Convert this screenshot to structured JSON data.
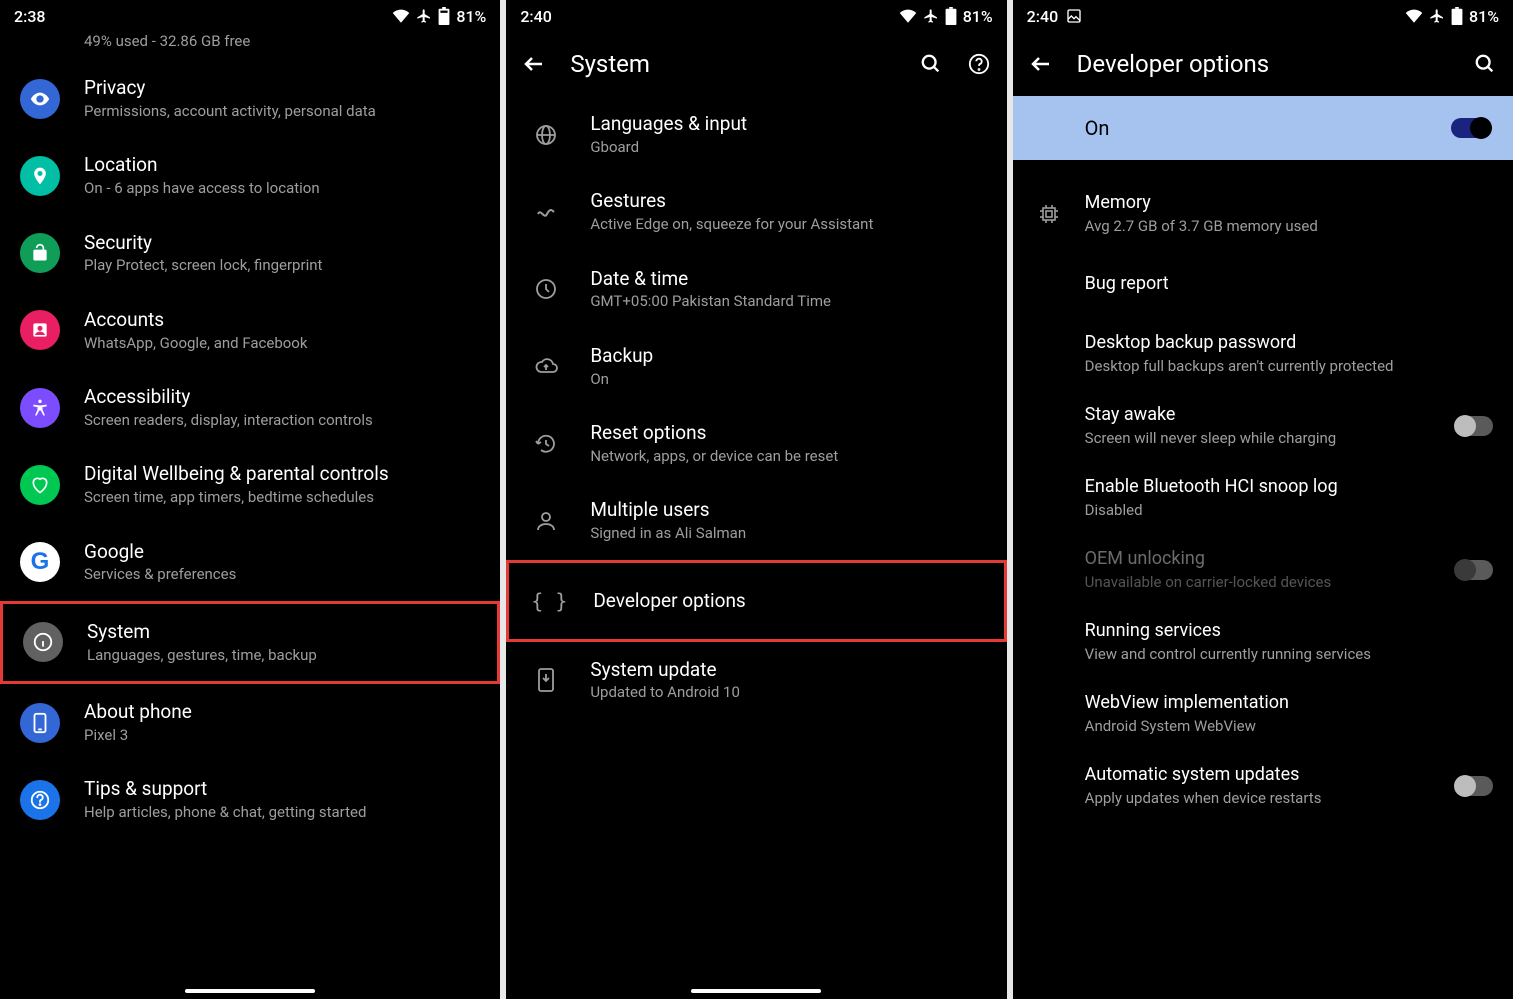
{
  "screen1": {
    "status": {
      "time": "2:38",
      "battery": "81%"
    },
    "storage_sub": "49% used - 32.86 GB free",
    "items": [
      {
        "title": "Privacy",
        "sub": "Permissions, account activity, personal data"
      },
      {
        "title": "Location",
        "sub": "On - 6 apps have access to location"
      },
      {
        "title": "Security",
        "sub": "Play Protect, screen lock, fingerprint"
      },
      {
        "title": "Accounts",
        "sub": "WhatsApp, Google, and Facebook"
      },
      {
        "title": "Accessibility",
        "sub": "Screen readers, display, interaction controls"
      },
      {
        "title": "Digital Wellbeing & parental controls",
        "sub": "Screen time, app timers, bedtime schedules"
      },
      {
        "title": "Google",
        "sub": "Services & preferences"
      },
      {
        "title": "System",
        "sub": "Languages, gestures, time, backup"
      },
      {
        "title": "About phone",
        "sub": "Pixel 3"
      },
      {
        "title": "Tips & support",
        "sub": "Help articles, phone & chat, getting started"
      }
    ]
  },
  "screen2": {
    "status": {
      "time": "2:40",
      "battery": "81%"
    },
    "header": "System",
    "items": [
      {
        "title": "Languages & input",
        "sub": "Gboard"
      },
      {
        "title": "Gestures",
        "sub": "Active Edge on, squeeze for your Assistant"
      },
      {
        "title": "Date & time",
        "sub": "GMT+05:00 Pakistan Standard Time"
      },
      {
        "title": "Backup",
        "sub": "On"
      },
      {
        "title": "Reset options",
        "sub": "Network, apps, or device can be reset"
      },
      {
        "title": "Multiple users",
        "sub": "Signed in as Ali Salman"
      },
      {
        "title": "Developer options",
        "sub": ""
      },
      {
        "title": "System update",
        "sub": "Updated to Android 10"
      }
    ]
  },
  "screen3": {
    "status": {
      "time": "2:40",
      "battery": "81%"
    },
    "header": "Developer options",
    "on_label": "On",
    "items": [
      {
        "title": "Memory",
        "sub": "Avg 2.7 GB of 3.7 GB memory used"
      },
      {
        "title": "Bug report",
        "sub": ""
      },
      {
        "title": "Desktop backup password",
        "sub": "Desktop full backups aren't currently protected"
      },
      {
        "title": "Stay awake",
        "sub": "Screen will never sleep while charging"
      },
      {
        "title": "Enable Bluetooth HCI snoop log",
        "sub": "Disabled"
      },
      {
        "title": "OEM unlocking",
        "sub": "Unavailable on carrier-locked devices"
      },
      {
        "title": "Running services",
        "sub": "View and control currently running services"
      },
      {
        "title": "WebView implementation",
        "sub": "Android System WebView"
      },
      {
        "title": "Automatic system updates",
        "sub": "Apply updates when device restarts"
      }
    ]
  }
}
